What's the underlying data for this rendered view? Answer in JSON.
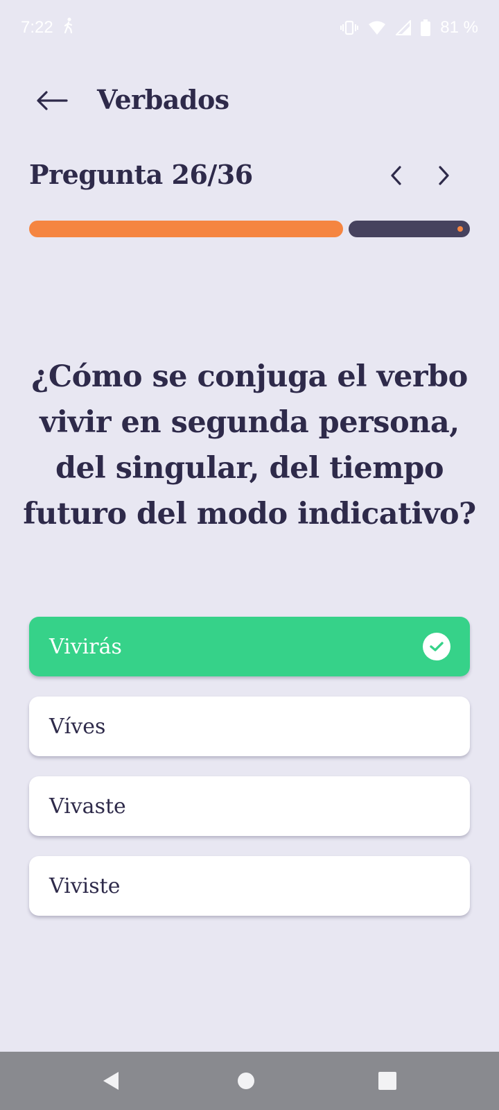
{
  "status_bar": {
    "time": "7:22",
    "battery": "81 %",
    "icons": [
      "walk-icon",
      "vibrate-icon",
      "wifi-icon",
      "signal-icon",
      "battery-icon"
    ]
  },
  "header": {
    "title": "Verbados"
  },
  "quiz": {
    "counter": "Pregunta 26/36",
    "progress_fraction": 0.722,
    "question": "¿Cómo se conjuga el verbo vivir en segunda persona, del singular, del tiempo futuro del modo indicativo?",
    "answers": [
      {
        "label": "Vivirás",
        "state": "correct"
      },
      {
        "label": "Víves",
        "state": "default"
      },
      {
        "label": "Vivaste",
        "state": "default"
      },
      {
        "label": "Viviste",
        "state": "default"
      }
    ]
  },
  "colors": {
    "background": "#e8e7f2",
    "text": "#2e2a4a",
    "progress_done": "#f58541",
    "progress_remaining": "#46425e",
    "correct": "#36d289",
    "nav_bar": "#898a8f"
  }
}
